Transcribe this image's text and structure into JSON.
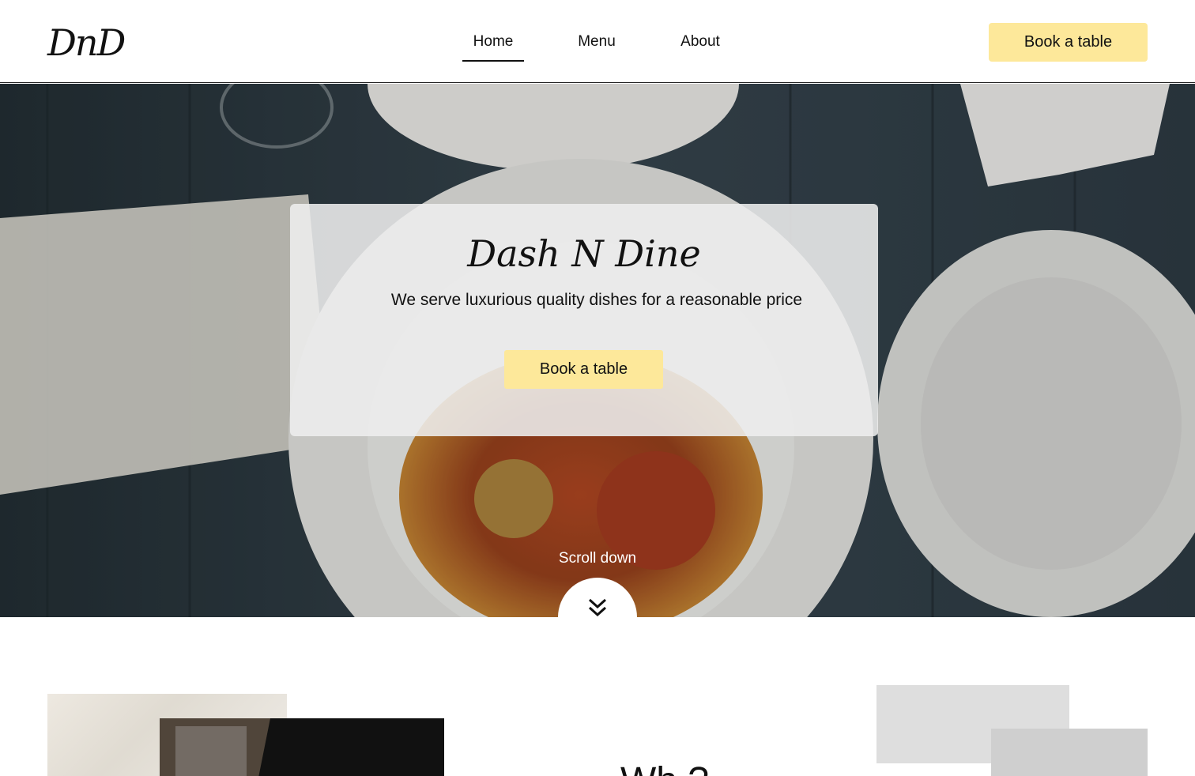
{
  "brand": {
    "logo_text": "DnD"
  },
  "nav": {
    "items": [
      {
        "label": "Home",
        "active": true
      },
      {
        "label": "Menu",
        "active": false
      },
      {
        "label": "About",
        "active": false
      }
    ],
    "cta_label": "Book a table"
  },
  "hero": {
    "title": "Dash N Dine",
    "subtitle": "We serve luxurious quality dishes for a reasonable price",
    "cta_label": "Book a table",
    "scroll_label": "Scroll down"
  },
  "section": {
    "heading_partial": "Wh          ?"
  },
  "colors": {
    "accent": "#fde89a",
    "text": "#111111",
    "background": "#ffffff"
  }
}
